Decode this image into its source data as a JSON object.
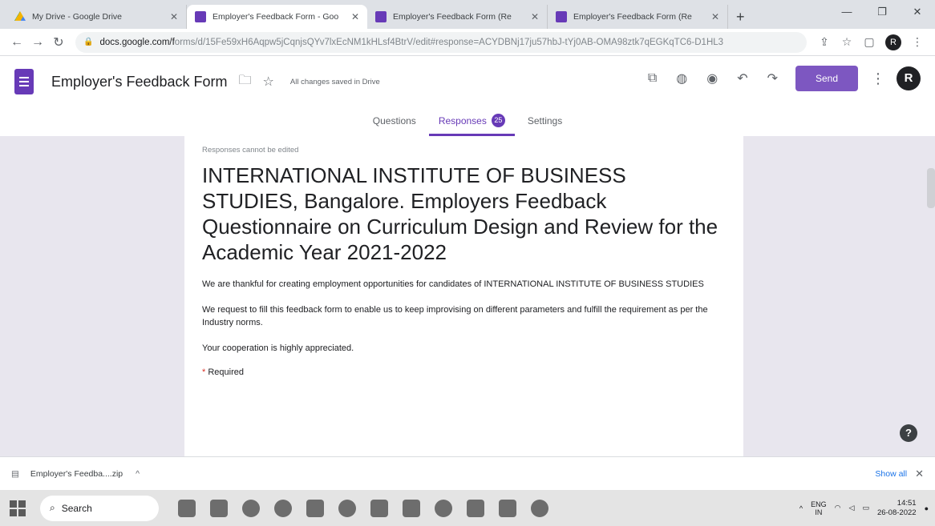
{
  "browser": {
    "tabs": [
      {
        "title": "My Drive - Google Drive",
        "icon": "drive-icon",
        "active": false
      },
      {
        "title": "Employer's Feedback Form - Goo",
        "icon": "forms-icon",
        "active": true
      },
      {
        "title": "Employer's Feedback Form (Re",
        "icon": "forms-icon",
        "active": false
      },
      {
        "title": "Employer's Feedback Form (Re",
        "icon": "forms-icon",
        "active": false
      }
    ],
    "url_host": "docs.google.com/f",
    "url_path": "orms/d/15Fe59xH6Aqpw5jCqnjsQYv7lxEcNM1kHLsf4BtrV/edit#response=ACYDBNj17ju57hbJ-tYj0AB-OMA98ztk7qEGKqTC6-D1HL3"
  },
  "forms_header": {
    "doc_title": "Employer's Feedback Form",
    "save_status": "All changes saved in Drive",
    "send_label": "Send",
    "avatar_letter": "R"
  },
  "form_tabs": {
    "questions": "Questions",
    "responses": "Responses",
    "responses_count": "25",
    "settings": "Settings"
  },
  "form": {
    "cannot_edit_note": "Responses cannot be edited",
    "title": "INTERNATIONAL INSTITUTE OF BUSINESS STUDIES, Bangalore. Employers Feedback Questionnaire on Curriculum Design and Review for the Academic Year 2021-2022",
    "desc_1": "We are  thankful for creating employment opportunities for candidates of INTERNATIONAL INSTITUTE OF BUSINESS STUDIES",
    "desc_2": "We request to fill  this feedback form to enable us to keep improvising on different parameters and fulfill the requirement as per the Industry norms.",
    "desc_3": "Your cooperation is highly appreciated.",
    "required_mark": "*",
    "required_text": "Required"
  },
  "download_bar": {
    "file_name": "Employer's Feedba....zip",
    "show_all": "Show all"
  },
  "taskbar": {
    "search_placeholder": "Search",
    "lang_top": "ENG",
    "lang_bottom": "IN",
    "time": "14:51",
    "date": "26-08-2022"
  }
}
